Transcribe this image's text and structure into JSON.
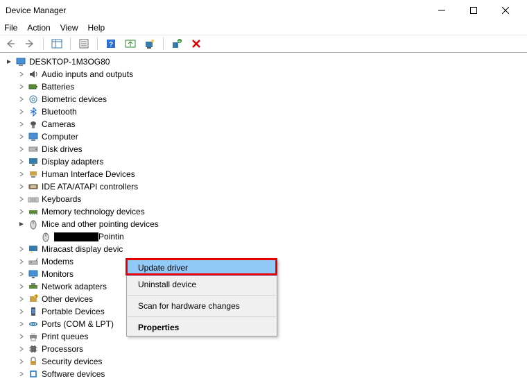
{
  "window": {
    "title": "Device Manager"
  },
  "menubar": [
    "File",
    "Action",
    "View",
    "Help"
  ],
  "root": "DESKTOP-1M3OG80",
  "categories": [
    {
      "label": "Audio inputs and outputs",
      "icon": "audio"
    },
    {
      "label": "Batteries",
      "icon": "battery"
    },
    {
      "label": "Biometric devices",
      "icon": "biometric"
    },
    {
      "label": "Bluetooth",
      "icon": "bluetooth"
    },
    {
      "label": "Cameras",
      "icon": "camera"
    },
    {
      "label": "Computer",
      "icon": "computer"
    },
    {
      "label": "Disk drives",
      "icon": "disk"
    },
    {
      "label": "Display adapters",
      "icon": "display"
    },
    {
      "label": "Human Interface Devices",
      "icon": "hid"
    },
    {
      "label": "IDE ATA/ATAPI controllers",
      "icon": "ide"
    },
    {
      "label": "Keyboards",
      "icon": "keyboard"
    },
    {
      "label": "Memory technology devices",
      "icon": "memory"
    },
    {
      "label": "Mice and other pointing devices",
      "icon": "mouse",
      "expanded": true
    },
    {
      "label": "Miracast display devic",
      "icon": "miracast"
    },
    {
      "label": "Modems",
      "icon": "modem"
    },
    {
      "label": "Monitors",
      "icon": "monitor"
    },
    {
      "label": "Network adapters",
      "icon": "network"
    },
    {
      "label": "Other devices",
      "icon": "other"
    },
    {
      "label": "Portable Devices",
      "icon": "portable"
    },
    {
      "label": "Ports (COM & LPT)",
      "icon": "ports"
    },
    {
      "label": "Print queues",
      "icon": "print"
    },
    {
      "label": "Processors",
      "icon": "cpu"
    },
    {
      "label": "Security devices",
      "icon": "security"
    },
    {
      "label": "Software devices",
      "icon": "software"
    }
  ],
  "mouse_child_suffix": "Pointin",
  "context_menu": {
    "items": [
      {
        "label": "Update driver",
        "highlighted": true
      },
      {
        "label": "Uninstall device"
      },
      {
        "label": "Scan for hardware changes"
      },
      {
        "label": "Properties",
        "bold": true
      }
    ]
  }
}
